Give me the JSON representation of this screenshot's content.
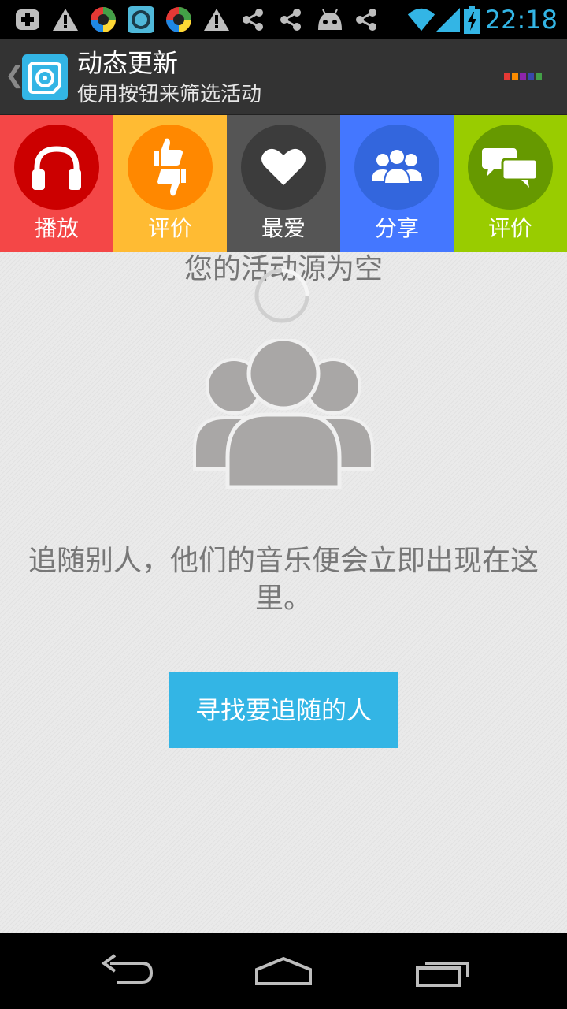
{
  "status_bar": {
    "time": "22:18",
    "icons": [
      "add-icon",
      "warning-icon",
      "app-circle-icon",
      "app-q-icon",
      "app-circle-icon",
      "warning-icon",
      "share-icon",
      "share-icon",
      "android-icon",
      "share-icon",
      "wifi-icon",
      "signal-icon",
      "battery-charging-icon"
    ],
    "accent_color": "#33b5e5"
  },
  "action_bar": {
    "title": "动态更新",
    "subtitle": "使用按钮来筛选活动",
    "menu_dot_colors": [
      "#e53935",
      "#fb8c00",
      "#8e24aa",
      "#3949ab",
      "#43a047"
    ]
  },
  "filters": [
    {
      "label": "播放",
      "icon": "headphones-icon",
      "bg": "#f44747",
      "circle": "#cc0000"
    },
    {
      "label": "评价",
      "icon": "thumbs-up-down-icon",
      "bg": "#ffbb33",
      "circle": "#ff8800"
    },
    {
      "label": "最爱",
      "icon": "heart-icon",
      "bg": "#555555",
      "circle": "#3c3c3c"
    },
    {
      "label": "分享",
      "icon": "group-icon",
      "bg": "#4477ff",
      "circle": "#3366dd"
    },
    {
      "label": "评价",
      "icon": "chat-bubbles-icon",
      "bg": "#99cc00",
      "circle": "#669900"
    }
  ],
  "content": {
    "empty_title": "您的活动源为空",
    "empty_message_line1": "追随别人，他们的音乐便会立即出现在这",
    "empty_message_line2": "里。",
    "button_label": "寻找要追随的人"
  },
  "nav_bar": {
    "icons": [
      "back-icon",
      "home-icon",
      "recent-apps-icon"
    ]
  }
}
